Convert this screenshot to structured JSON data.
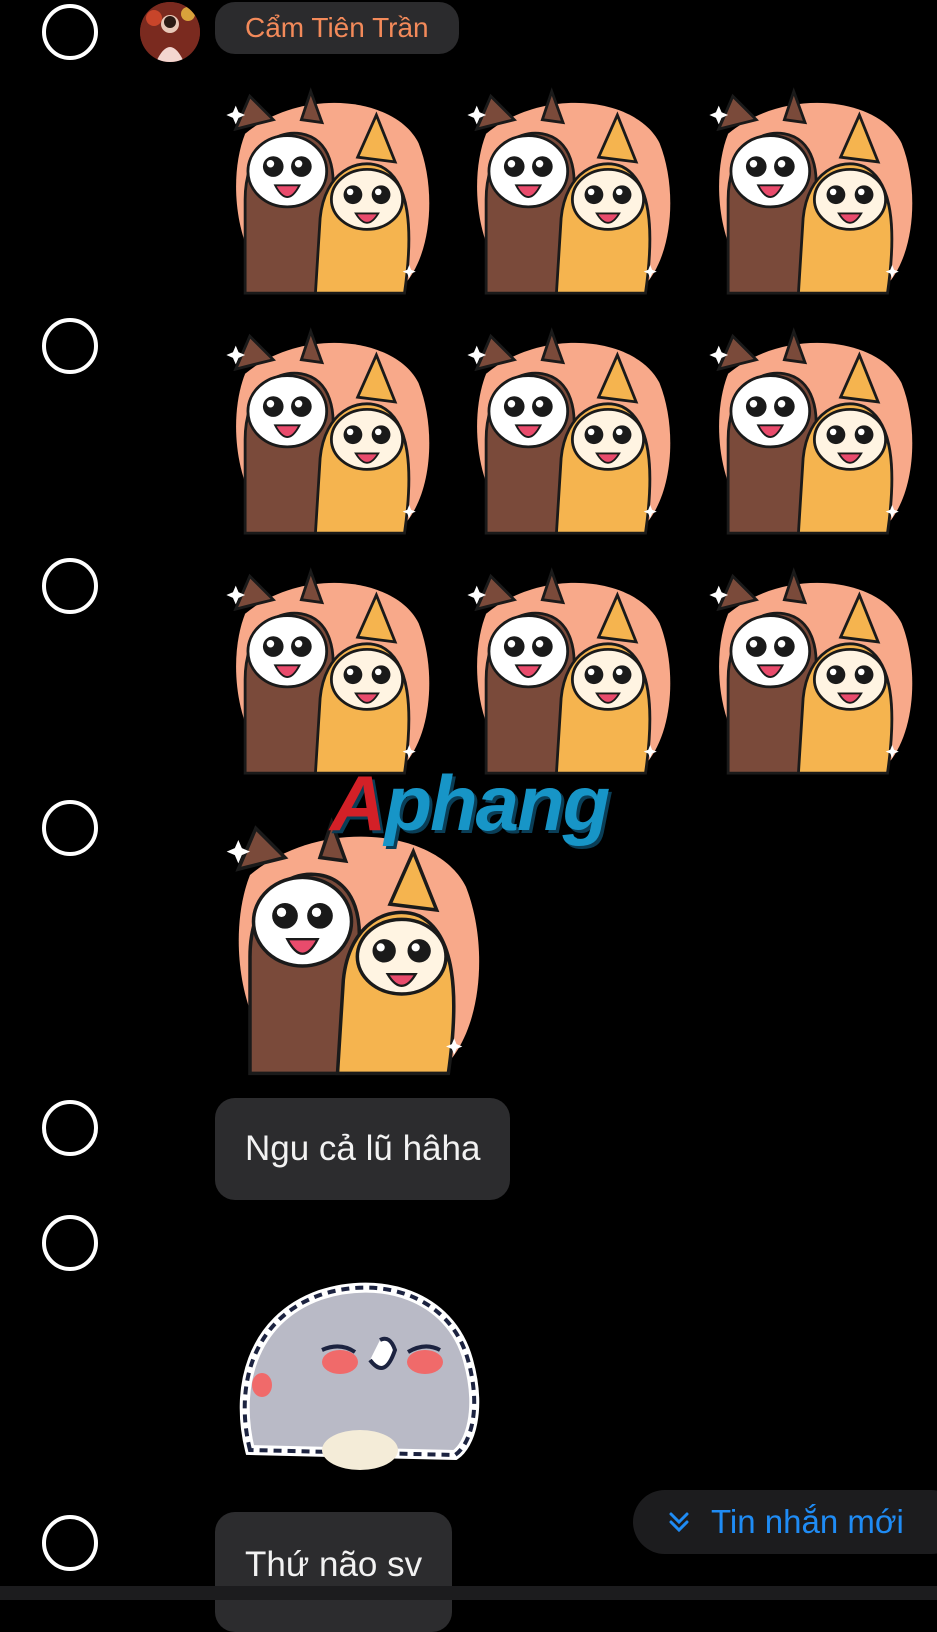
{
  "chat": {
    "sender_name": "Cẩm Tiên Trần",
    "messages": [
      {
        "type": "text",
        "text": "Ngu cả lũ hâha"
      },
      {
        "type": "text",
        "text": "Thứ não sv"
      }
    ],
    "watermark": {
      "first": "A",
      "rest": "phang"
    }
  },
  "new_messages_button": {
    "label": "Tin nhắn mới",
    "icon": "double-chevron-down-icon"
  },
  "colors": {
    "background": "#000000",
    "bubble": "#2c2c2e",
    "sender_name": "#f38a5a",
    "accent": "#1f8cf5"
  }
}
